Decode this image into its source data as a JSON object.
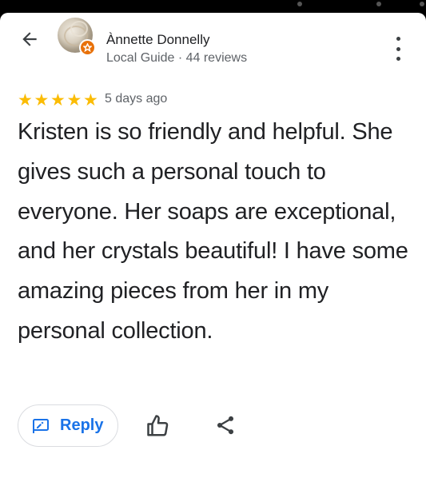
{
  "header": {
    "back_icon": "arrow-back-icon",
    "reviewer_name": "Ànnette Donnelly",
    "reviewer_subtitle": "Local Guide · 44 reviews",
    "badge_icon": "local-guide-star-icon",
    "more_icon": "more-vertical-icon"
  },
  "review": {
    "rating": 5,
    "rating_max": 5,
    "star_color": "#fbbc04",
    "date": "5 days ago",
    "text": "Kristen is so friendly and helpful. She gives such a personal touch to everyone. Her soaps are exceptional, and her crystals beautiful! I have some amazing pieces from her in my personal collection."
  },
  "actions": {
    "reply_label": "Reply",
    "reply_icon": "reply-icon",
    "like_icon": "thumb-up-icon",
    "share_icon": "share-icon",
    "accent_color": "#1a73e8"
  }
}
